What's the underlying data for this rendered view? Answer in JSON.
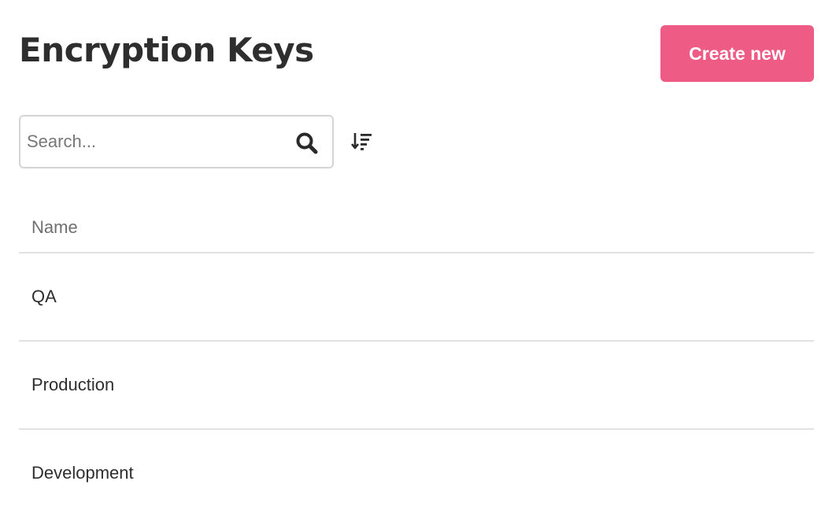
{
  "header": {
    "title": "Encryption Keys",
    "create_label": "Create new",
    "accent_color": "#ee5c86"
  },
  "toolbar": {
    "search_placeholder": "Search...",
    "search_value": "",
    "search_icon": "search-icon",
    "sort_icon": "sort-descending-icon"
  },
  "table": {
    "columns": [
      "Name"
    ],
    "rows": [
      {
        "name": "QA"
      },
      {
        "name": "Production"
      },
      {
        "name": "Development"
      }
    ]
  }
}
